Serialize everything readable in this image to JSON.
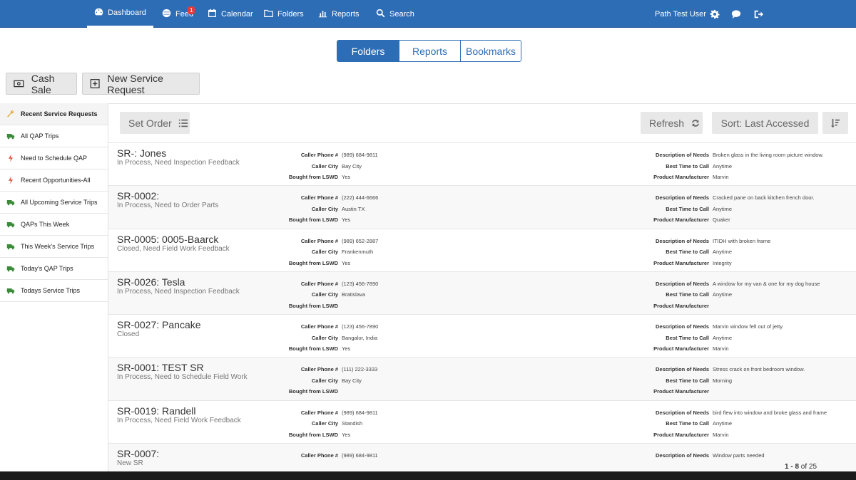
{
  "nav": {
    "items": [
      {
        "label": "Dashboard",
        "icon": "dashboard-icon"
      },
      {
        "label": "Feed",
        "icon": "globe-icon",
        "badge": "1"
      },
      {
        "label": "Calendar",
        "icon": "calendar-icon"
      },
      {
        "label": "Folders",
        "icon": "folder-icon"
      },
      {
        "label": "Reports",
        "icon": "bar-chart-icon"
      },
      {
        "label": "Search",
        "icon": "search-icon"
      }
    ],
    "user": "Path Test User"
  },
  "tabs": [
    "Folders",
    "Reports",
    "Bookmarks"
  ],
  "actions": {
    "cash_sale": "Cash Sale",
    "new_request": "New Service Request"
  },
  "sidebar": [
    {
      "label": "Recent Service Requests",
      "icon": "wrench-icon"
    },
    {
      "label": "All QAP Trips",
      "icon": "truck-icon"
    },
    {
      "label": "Need to Schedule QAP",
      "icon": "lightning-icon"
    },
    {
      "label": "Recent Opportunities-All",
      "icon": "lightning-icon"
    },
    {
      "label": "All Upcoming Service Trips",
      "icon": "truck-icon"
    },
    {
      "label": "QAPs This Week",
      "icon": "truck-icon"
    },
    {
      "label": "This Week's Service Trips",
      "icon": "truck-icon"
    },
    {
      "label": "Today's QAP Trips",
      "icon": "truck-icon"
    },
    {
      "label": "Todays Service Trips",
      "icon": "truck-icon"
    }
  ],
  "toolbar": {
    "set_order": "Set Order",
    "refresh": "Refresh",
    "sort": "Sort: Last Accessed"
  },
  "labels": {
    "phone": "Caller Phone #",
    "city": "Caller City",
    "bought": "Bought from LSWD",
    "desc": "Description of Needs",
    "best_time": "Best Time to Call",
    "manufacturer": "Product Manufacturer"
  },
  "records": [
    {
      "title": "SR-: Jones",
      "status": "In Process, Need Inspection Feedback",
      "phone": "(989) 684-9811",
      "city": "Bay City",
      "bought": "Yes",
      "desc": "Broken glass in the living room picture window.",
      "best_time": "Anytime",
      "manufacturer": "Marvin"
    },
    {
      "title": "SR-0002:",
      "status": "In Process, Need to Order Parts",
      "phone": "(222) 444-6666",
      "city": "Austin TX",
      "bought": "Yes",
      "desc": "Cracked pane on back kitchen french door.",
      "best_time": "Anytime",
      "manufacturer": "Quaker"
    },
    {
      "title": "SR-0005: 0005-Baarck",
      "status": "Closed, Need Field Work Feedback",
      "phone": "(989) 652-2887",
      "city": "Frankenmuth",
      "bought": "Yes",
      "desc": "ITIDH with broken frame",
      "best_time": "Anytime",
      "manufacturer": "Integrity"
    },
    {
      "title": "SR-0026: Tesla",
      "status": "In Process, Need Inspection Feedback",
      "phone": "(123) 456-7890",
      "city": "Bratislava",
      "bought": "",
      "desc": "A window for my van & one for my dog house",
      "best_time": "Anytime",
      "manufacturer": ""
    },
    {
      "title": "SR-0027: Pancake",
      "status": "Closed",
      "phone": "(123) 456-7890",
      "city": "Bangalor, India",
      "bought": "Yes",
      "desc": "Marvin window fell out of jetty.",
      "best_time": "Anytime",
      "manufacturer": "Marvin"
    },
    {
      "title": "SR-0001: TEST SR",
      "status": "In Process, Need to Schedule Field Work",
      "phone": "(111) 222-3333",
      "city": "Bay City",
      "bought": "",
      "desc": "Stress crack on front bedroom window.",
      "best_time": "Morning",
      "manufacturer": ""
    },
    {
      "title": "SR-0019: Randell",
      "status": "In Process, Need Field Work Feedback",
      "phone": "(989) 684-9811",
      "city": "Standish",
      "bought": "Yes",
      "desc": "bird flew into window and broke glass and frame",
      "best_time": "Anytime",
      "manufacturer": "Marvin"
    },
    {
      "title": "SR-0007:",
      "status": "New SR",
      "phone": "(989) 684-9811",
      "city": "",
      "bought": "",
      "desc": "Window parts needed",
      "best_time": "",
      "manufacturer": ""
    }
  ],
  "pager": {
    "range": "1 - 8",
    "of": "of 25"
  },
  "colors": {
    "nav": "#2d6db5",
    "truck": "#3a8a3a",
    "lightning": "#e0533a",
    "wrench": "#e2a22c"
  }
}
